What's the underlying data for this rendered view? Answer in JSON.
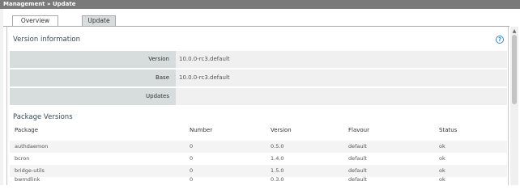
{
  "breadcrumb": {
    "parent": "Management",
    "separator": "»",
    "current": "Update"
  },
  "tabs": [
    {
      "label": "Overview",
      "active": true
    },
    {
      "label": "Update",
      "active": false
    }
  ],
  "version_info": {
    "title": "Version information",
    "help_icon": "?",
    "rows": [
      {
        "key": "Version",
        "value": "10.0.0-rc3.default"
      },
      {
        "key": "Base",
        "value": "10.0.0-rc3.default"
      },
      {
        "key": "Updates",
        "value": ""
      }
    ]
  },
  "packages": {
    "title": "Package Versions",
    "columns": [
      "Package",
      "Number",
      "Version",
      "Flavour",
      "Status"
    ],
    "rows": [
      {
        "package": "authdaemon",
        "number": "0",
        "version": "0.5.0",
        "flavour": "default",
        "status": "ok"
      },
      {
        "package": "bcron",
        "number": "0",
        "version": "1.4.0",
        "flavour": "default",
        "status": "ok"
      },
      {
        "package": "bridge-utils",
        "number": "0",
        "version": "1.5.0",
        "flavour": "default",
        "status": "ok"
      },
      {
        "package": "bwmdlink",
        "number": "0",
        "version": "0.3.0",
        "flavour": "default",
        "status": "ok"
      }
    ]
  },
  "colors": {
    "topbar": "#7a7a7a",
    "key_bg": "#d7dcdd",
    "value_bg": "#f0f0f0",
    "help_icon": "#3a84c0"
  }
}
